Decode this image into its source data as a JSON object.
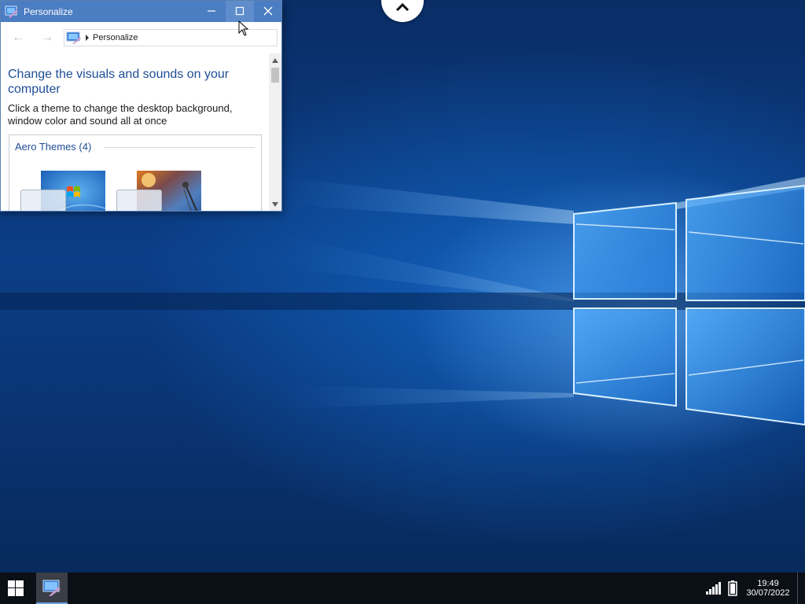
{
  "window": {
    "title": "Personalize",
    "icon": "personalize-icon",
    "controls": {
      "minimize": "minimize-icon",
      "maximize": "maximize-icon",
      "close": "close-icon"
    }
  },
  "nav": {
    "back": "←",
    "forward": "→",
    "breadcrumb": "Personalize"
  },
  "content": {
    "heading": "Change the visuals and sounds on your computer",
    "subtext": "Click a theme to change the desktop background, window color and sound all at once",
    "group_label": "Aero Themes (4)"
  },
  "taskbar": {
    "time": "19:49",
    "date": "30/07/2022"
  },
  "colors": {
    "title_bar": "#4b7dc2",
    "heading_text": "#1e4e96",
    "taskbar": "#0b0f16",
    "desktop_blue": "#0b3e86"
  }
}
